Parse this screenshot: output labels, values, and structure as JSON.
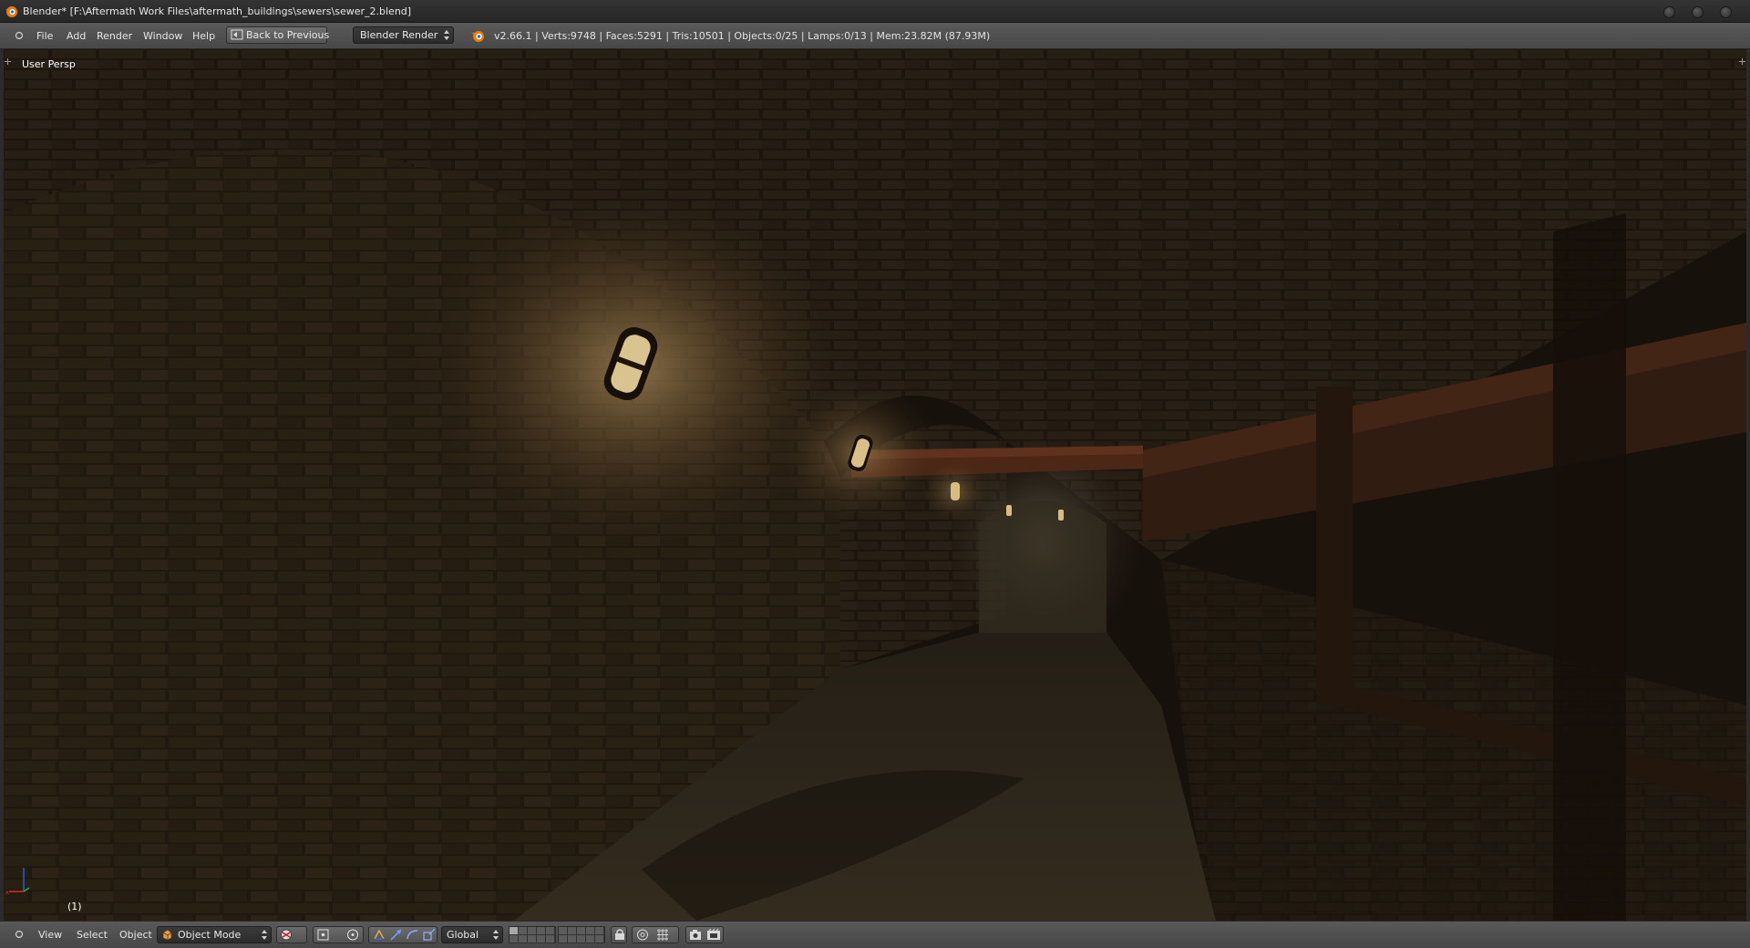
{
  "window": {
    "title": "Blender* [F:\\Aftermath Work Files\\aftermath_buildings\\sewers\\sewer_2.blend]",
    "icon": "blender-app-icon",
    "controls": [
      "minimize-icon",
      "maximize-icon",
      "close-icon"
    ]
  },
  "info_header": {
    "menus": [
      "File",
      "Add",
      "Render",
      "Window",
      "Help"
    ],
    "back_button_label": "Back to Previous",
    "render_engine": "Blender Render",
    "stats": "v2.66.1 | Verts:9748 | Faces:5291 | Tris:10501 | Objects:0/25 | Lamps:0/13 | Mem:23.82M (87.93M)"
  },
  "viewport": {
    "view_name": "User Persp",
    "frame_label": "(1)"
  },
  "viewport_header": {
    "menus": [
      "View",
      "Select",
      "Object"
    ],
    "mode": "Object Mode",
    "orientation": "Global",
    "tools": [
      "shading-icon",
      "pivot-icon",
      "manipulator-icon",
      "translate-icon",
      "rotate-icon",
      "scale-icon",
      "layers-icon",
      "lock-icon",
      "snap-icon",
      "render-icon",
      "render-anim-icon"
    ]
  },
  "colors": {
    "header": "#4e4e4e",
    "titlebar": "#2e2e2e",
    "lamp_glow": "#ffd58a",
    "brick": "#4a3a26",
    "pipe_rust": "#6a3a22"
  }
}
